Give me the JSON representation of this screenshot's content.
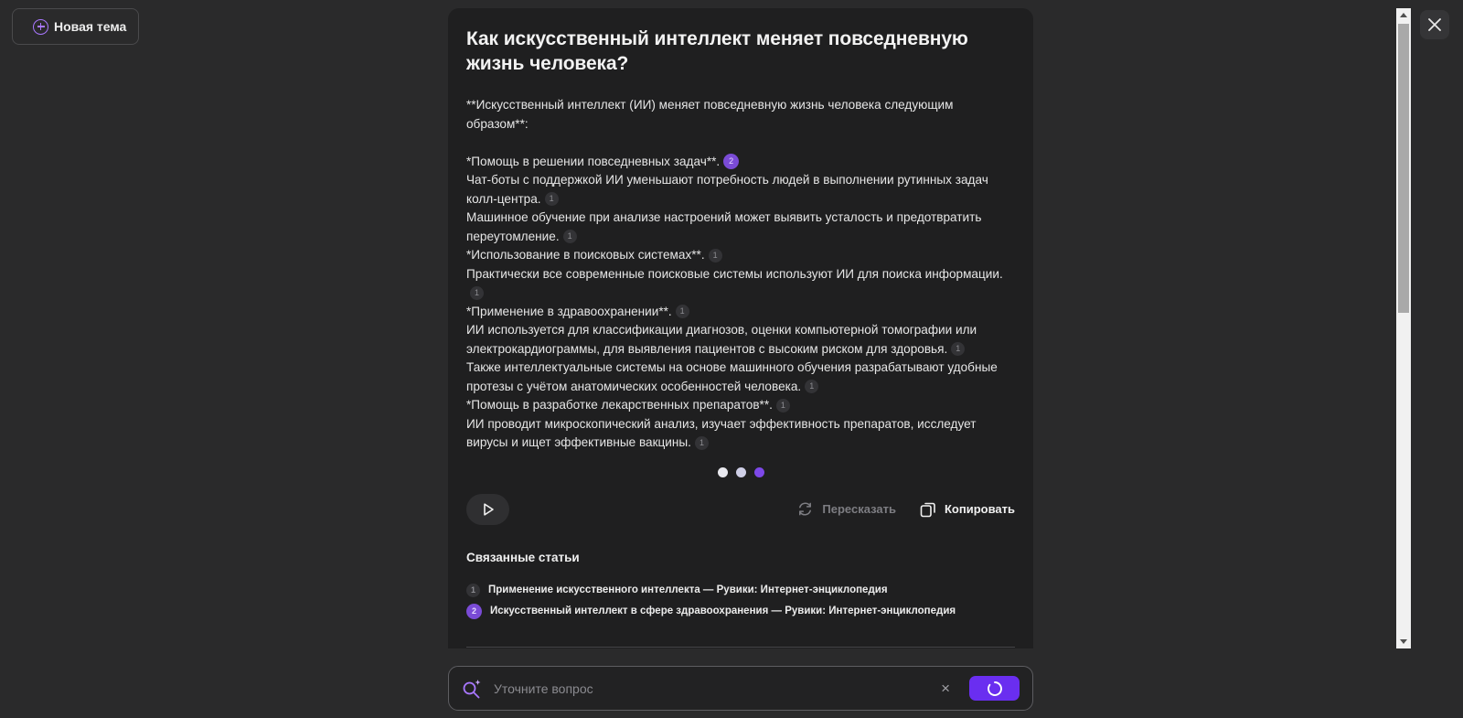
{
  "new_topic_label": "Новая тема",
  "title": "Как искусственный интеллект меняет повседневную жизнь человека?",
  "answer_lines": [
    {
      "text": "**Искусственный интеллект (ИИ) меняет повседневную жизнь человека следующим",
      "ref": ""
    },
    {
      "text": "образом**:",
      "ref": ""
    },
    {
      "text": " *Помощь в решении повседневных задач**.",
      "ref": "2"
    },
    {
      "text": "Чат-боты с поддержкой ИИ уменьшают потребность людей в выполнении рутинных задач",
      "ref": ""
    },
    {
      "text": "колл-центра.",
      "ref": "1"
    },
    {
      "text": "Машинное обучение при анализе настроений может выявить усталость и предотвратить",
      "ref": ""
    },
    {
      "text": "переутомление.",
      "ref": "1"
    },
    {
      "text": " *Использование в поисковых системах**.",
      "ref": "1"
    },
    {
      "text": "Практически все современные поисковые системы используют ИИ для поиска информации.",
      "ref": ""
    },
    {
      "text": "",
      "ref": "1"
    },
    {
      "text": " *Применение в здравоохранении**.",
      "ref": "1"
    },
    {
      "text": "ИИ используется для классификации диагнозов, оценки компьютерной томографии или",
      "ref": ""
    },
    {
      "text": "электрокардиограммы, для выявления пациентов с высоким риском для здоровья.",
      "ref": "1"
    },
    {
      "text": "Также интеллектуальные системы на основе машинного обучения разрабатывают удобные",
      "ref": ""
    },
    {
      "text": "протезы с учётом анатомических особенностей человека.",
      "ref": "1"
    },
    {
      "text": " *Помощь в разработке лекарственных препаратов**.",
      "ref": "1"
    },
    {
      "text": "ИИ проводит микроскопический анализ, изучает эффективность препаратов, исследует",
      "ref": ""
    },
    {
      "text": "вирусы и ищет эффективные вакцины.",
      "ref": "1"
    }
  ],
  "actions": {
    "retell_label": "Пересказать",
    "copy_label": "Копировать"
  },
  "related": {
    "title": "Связанные статьи",
    "items": [
      {
        "num": "1",
        "label": "Применение искусственного интеллекта — Рувики: Интернет-энциклопедия"
      },
      {
        "num": "2",
        "label": "Искусственный интеллект в сфере здравоохранения — Рувики: Интернет-энциклопедия"
      }
    ]
  },
  "input": {
    "placeholder": "Уточните вопрос",
    "value": ""
  },
  "colors": {
    "accent": "#6a2ef0",
    "accent_light": "#a877ff",
    "background": "#2a2a2b",
    "panel": "#1f1f20"
  },
  "icons": {
    "new_topic": "plus-circle-icon",
    "close": "close-icon",
    "play": "play-icon",
    "retell": "refresh-icon",
    "copy": "copy-icon",
    "search": "ai-search-icon",
    "clear": "clear-icon",
    "submit": "spinner-icon"
  }
}
